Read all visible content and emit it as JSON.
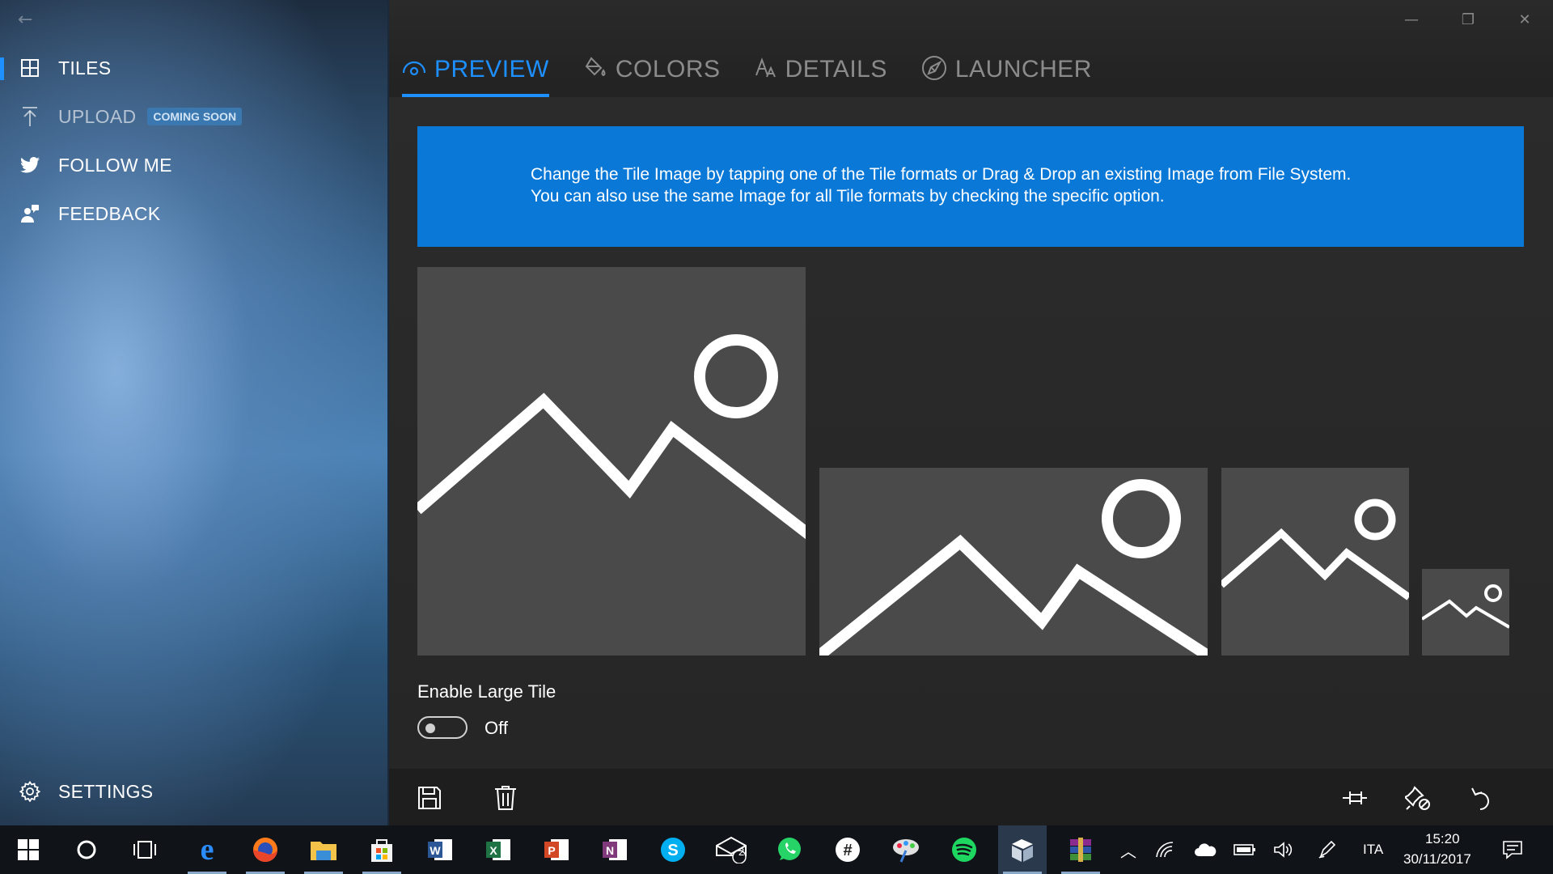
{
  "sidebar": {
    "items": [
      {
        "label": "TILES",
        "icon": "grid-icon"
      },
      {
        "label": "UPLOAD",
        "icon": "upload-icon",
        "badge": "COMING SOON"
      },
      {
        "label": "FOLLOW ME",
        "icon": "twitter-icon"
      },
      {
        "label": "FEEDBACK",
        "icon": "feedback-icon"
      }
    ],
    "settings_label": "SETTINGS"
  },
  "tabs": [
    {
      "label": "PREVIEW",
      "icon": "eye-icon",
      "active": true
    },
    {
      "label": "COLORS",
      "icon": "paint-bucket-icon"
    },
    {
      "label": "DETAILS",
      "icon": "font-size-icon"
    },
    {
      "label": "LAUNCHER",
      "icon": "rocket-icon"
    }
  ],
  "banner": {
    "line1": "Change the Tile Image by tapping one of the Tile formats or Drag & Drop an existing Image from File System.",
    "line2": "You can also use the same Image for all Tile formats by checking the specific option."
  },
  "large_tile": {
    "label": "Enable Large Tile",
    "state": "Off"
  },
  "colors": {
    "accent": "#0a78d7",
    "tab_active": "#1e8fff",
    "tile_bg": "#4a4a4a"
  },
  "taskbar": {
    "mail_badge": "2",
    "language": "ITA",
    "time": "15:20",
    "date": "30/11/2017"
  }
}
